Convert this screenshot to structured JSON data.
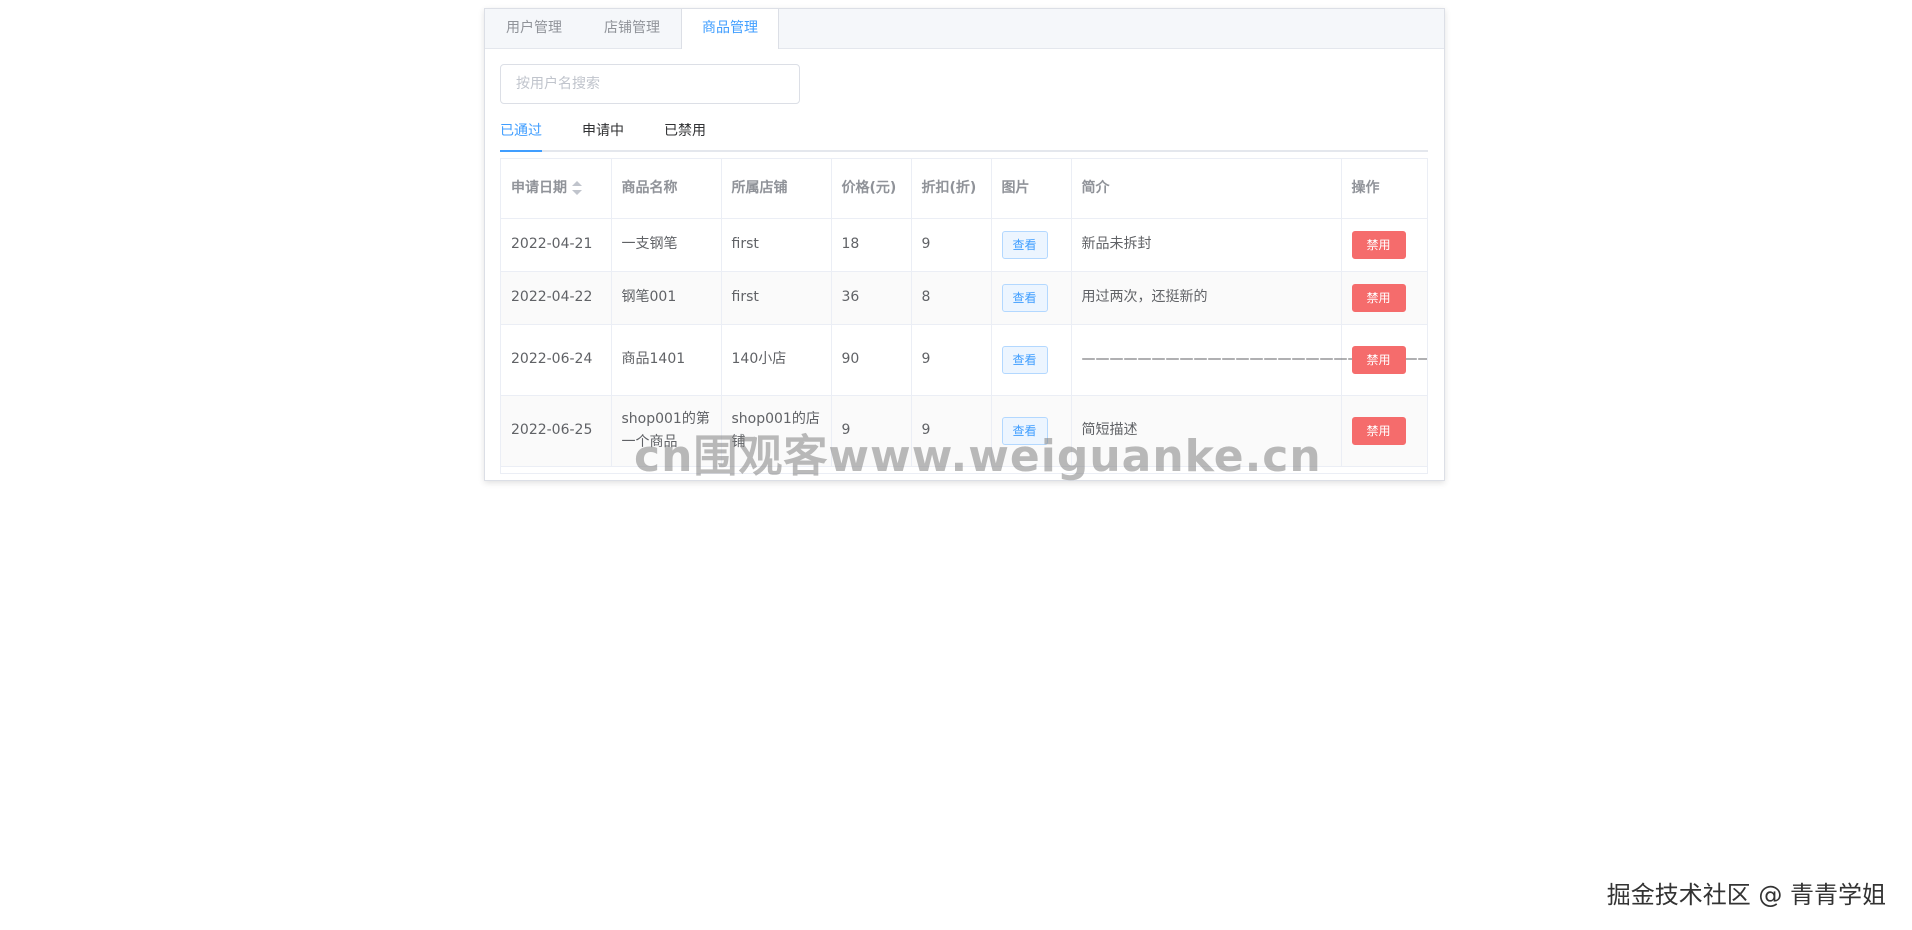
{
  "top_tabs": [
    {
      "label": "用户管理"
    },
    {
      "label": "店铺管理"
    },
    {
      "label": "商品管理"
    }
  ],
  "active_top_tab": 2,
  "search": {
    "placeholder": "按用户名搜索",
    "value": ""
  },
  "sub_tabs": [
    {
      "label": "已通过"
    },
    {
      "label": "申请中"
    },
    {
      "label": "已禁用"
    }
  ],
  "table": {
    "headers": {
      "date": "申请日期",
      "name": "商品名称",
      "shop": "所属店铺",
      "price": "价格(元)",
      "discount": "折扣(折)",
      "image": "图片",
      "intro": "简介",
      "action": "操作"
    },
    "rows": [
      {
        "date": "2022-04-21",
        "name": "一支钢笔",
        "shop": "first",
        "price": "18",
        "discount": "9",
        "view_label": "查看",
        "intro": "新品未拆封",
        "ban_label": "禁用"
      },
      {
        "date": "2022-04-22",
        "name": "钢笔001",
        "shop": "first",
        "price": "36",
        "discount": "8",
        "view_label": "查看",
        "intro": "用过两次，还挺新的",
        "ban_label": "禁用"
      },
      {
        "date": "2022-06-24",
        "name": "商品1401",
        "shop": "140小店",
        "price": "90",
        "discount": "9",
        "view_label": "查看",
        "intro": "——————————————————————————",
        "ban_label": "禁用"
      },
      {
        "date": "2022-06-25",
        "name": "shop001的第一个商品",
        "shop": "shop001的店铺",
        "price": "9",
        "discount": "9",
        "view_label": "查看",
        "intro": "简短描述",
        "ban_label": "禁用"
      }
    ]
  },
  "watermark": "cn围观客www.weiguanke.cn",
  "credit": "掘金技术社区 @ 青青学姐",
  "colors": {
    "primary": "#409eff",
    "danger": "#f56c6c",
    "border": "#ebeef5"
  }
}
